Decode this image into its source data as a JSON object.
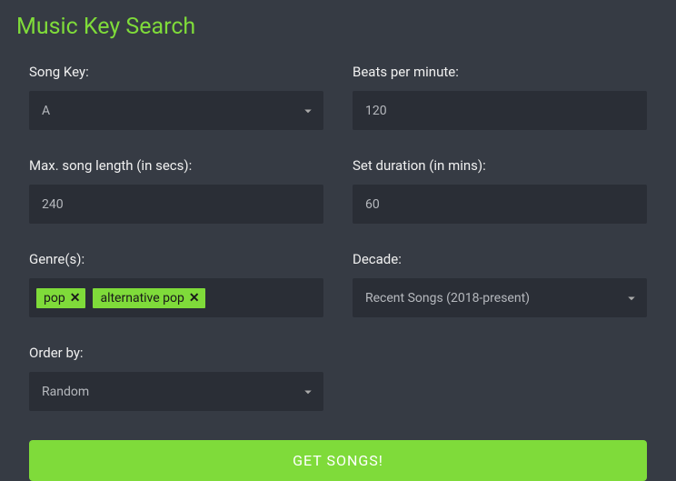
{
  "title": "Music Key Search",
  "labels": {
    "song_key": "Song Key:",
    "bpm": "Beats per minute:",
    "max_length": "Max. song length (in secs):",
    "set_duration": "Set duration (in mins):",
    "genres": "Genre(s):",
    "decade": "Decade:",
    "order_by": "Order by:"
  },
  "values": {
    "song_key": "A",
    "bpm": "120",
    "max_length": "240",
    "set_duration": "60",
    "decade": "Recent Songs (2018-present)",
    "order_by": "Random"
  },
  "genres": [
    "pop",
    "alternative pop"
  ],
  "submit": "GET SONGS!"
}
